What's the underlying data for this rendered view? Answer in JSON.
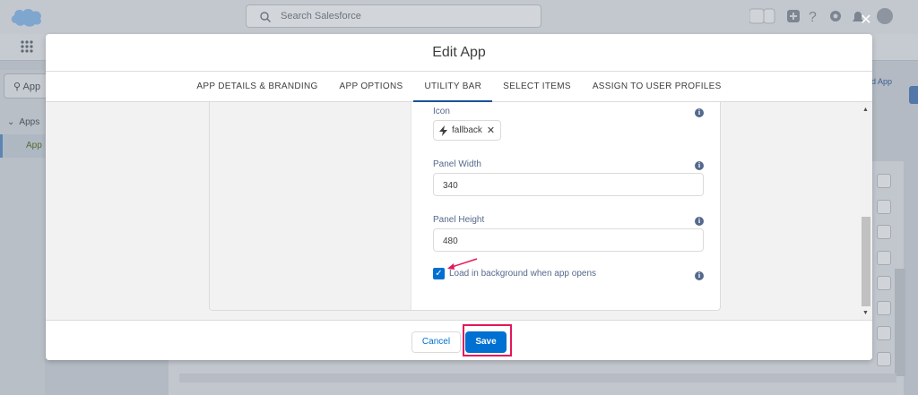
{
  "background": {
    "search_placeholder": "Search Salesforce",
    "sidebar_search_value": "App",
    "sidebar_group_label": "Apps",
    "sidebar_selected_item": "App",
    "right_link": "d App"
  },
  "modal": {
    "title": "Edit App",
    "close_icon": "close-icon",
    "tabs": [
      {
        "label": "App Details & Branding",
        "active": false
      },
      {
        "label": "App Options",
        "active": false
      },
      {
        "label": "Utility Bar",
        "active": true
      },
      {
        "label": "Select Items",
        "active": false
      },
      {
        "label": "Assign to User Profiles",
        "active": false
      }
    ],
    "form": {
      "icon_label": "Icon",
      "icon_pill_value": "fallback",
      "panel_width_label": "Panel Width",
      "panel_width_value": "340",
      "panel_height_label": "Panel Height",
      "panel_height_value": "480",
      "load_background_label": "Load in background when app opens",
      "load_background_checked": true
    },
    "footer": {
      "cancel_label": "Cancel",
      "save_label": "Save"
    }
  },
  "colors": {
    "brand": "#0070d2",
    "highlight": "#e2185b",
    "active_tab": "#1b5297"
  }
}
